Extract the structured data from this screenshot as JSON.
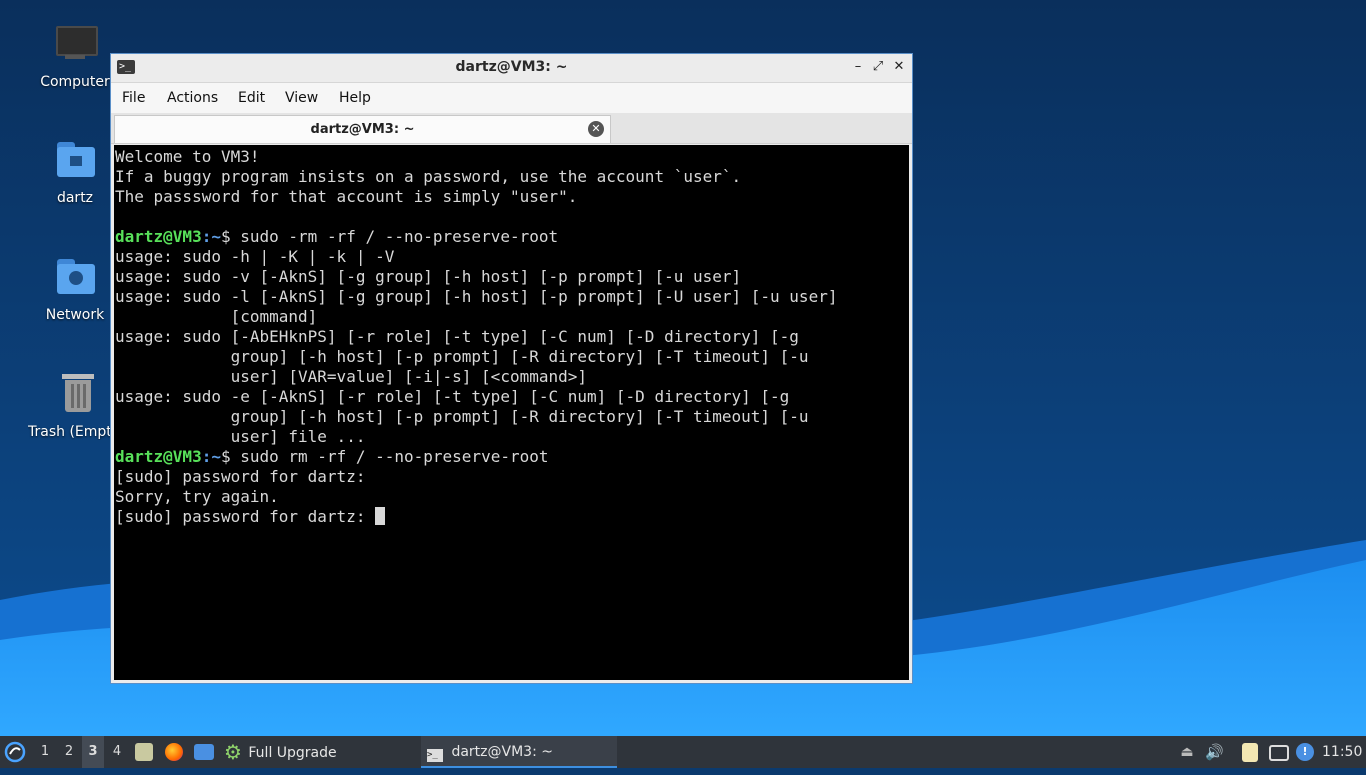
{
  "desktop": {
    "icons": [
      {
        "label": "Computer"
      },
      {
        "label": "dartz"
      },
      {
        "label": "Network"
      },
      {
        "label": "Trash (Empty)"
      }
    ]
  },
  "window": {
    "title": "dartz@VM3: ~",
    "menu": [
      "File",
      "Actions",
      "Edit",
      "View",
      "Help"
    ],
    "tab_label": "dartz@VM3: ~",
    "prompt_user": "dartz@VM3",
    "prompt_path": ":~",
    "prompt_sign": "$",
    "terminal_lines": [
      "Welcome to VM3!",
      "If a buggy program insists on a password, use the account `user`.",
      "The passsword for that account is simply \"user\".",
      "",
      "",
      "usage: sudo -h | -K | -k | -V",
      "usage: sudo -v [-AknS] [-g group] [-h host] [-p prompt] [-u user]",
      "usage: sudo -l [-AknS] [-g group] [-h host] [-p prompt] [-U user] [-u user]",
      "            [command]",
      "usage: sudo [-AbEHknPS] [-r role] [-t type] [-C num] [-D directory] [-g",
      "            group] [-h host] [-p prompt] [-R directory] [-T timeout] [-u",
      "            user] [VAR=value] [-i|-s] [<command>]",
      "usage: sudo -e [-AknS] [-r role] [-t type] [-C num] [-D directory] [-g",
      "            group] [-h host] [-p prompt] [-R directory] [-T timeout] [-u",
      "            user] file ...",
      "",
      "[sudo] password for dartz:",
      "Sorry, try again.",
      "[sudo] password for dartz: "
    ],
    "command_1": " sudo -rm -rf / --no-preserve-root",
    "command_2": " sudo rm -rf / --no-preserve-root"
  },
  "taskbar": {
    "workspaces": [
      "1",
      "2",
      "3",
      "4"
    ],
    "active_workspace": "3",
    "task_upgrade": "Full Upgrade",
    "task_terminal": "dartz@VM3: ~",
    "clock": "11:50"
  }
}
